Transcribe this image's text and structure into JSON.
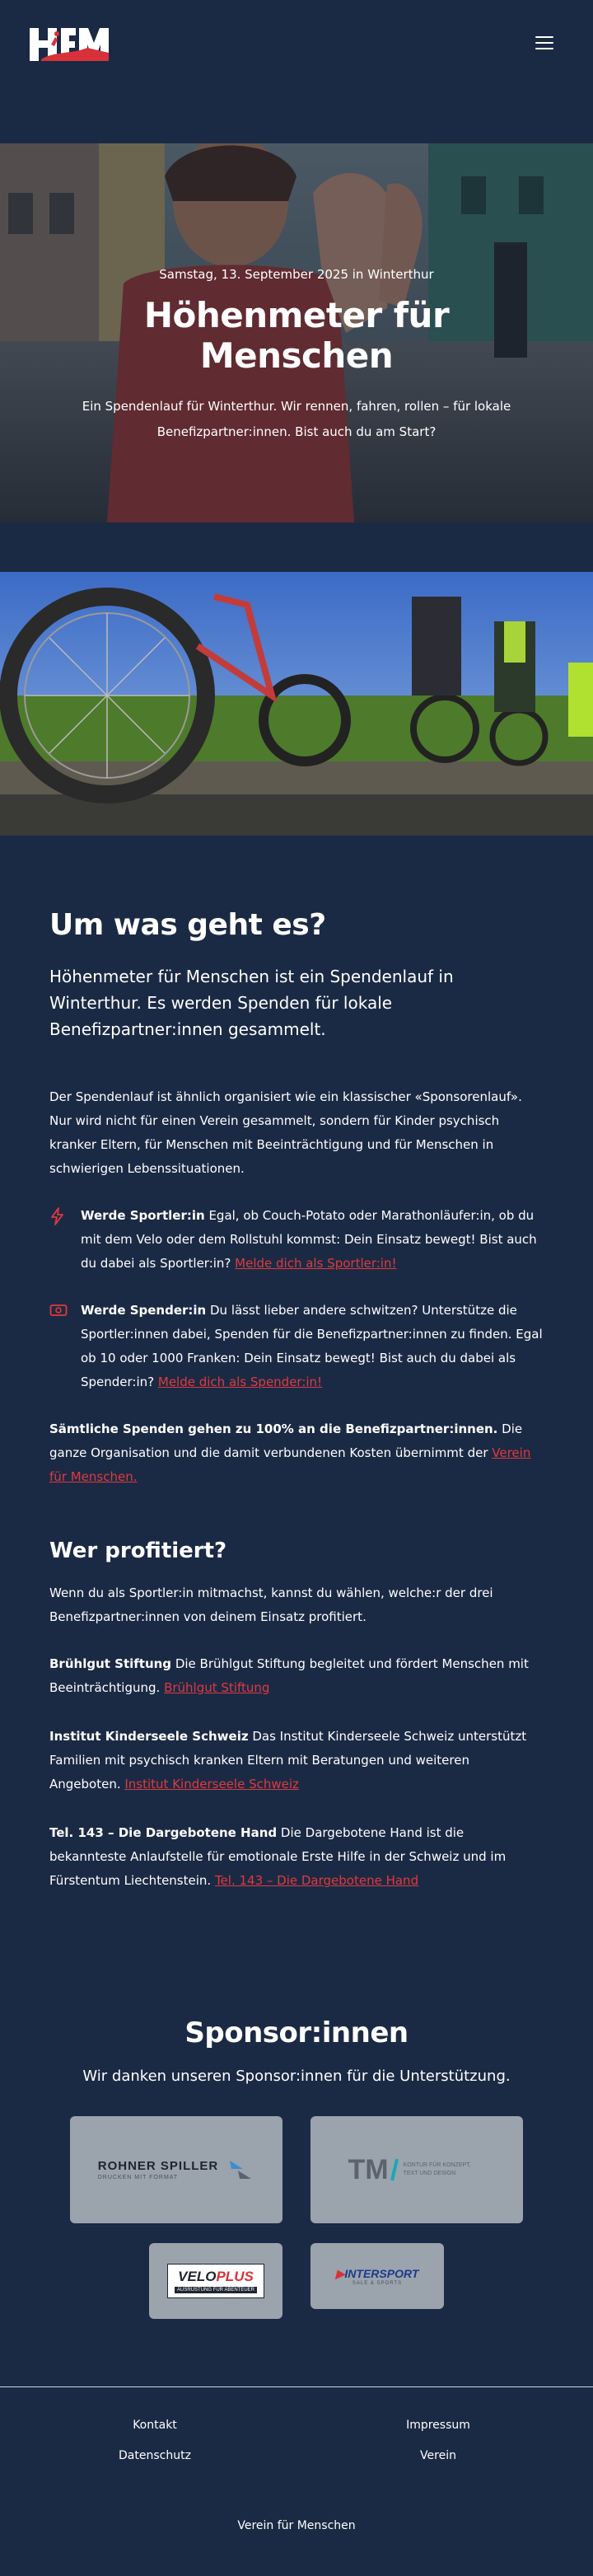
{
  "header": {
    "logo_text": "HfM",
    "menu_icon": "hamburger-icon"
  },
  "hero": {
    "date": "Samstag, 13. September 2025 in Winterthur",
    "title": "Höhenmeter für Menschen",
    "subtitle": "Ein Spendenlauf für Winterthur. Wir rennen, fahren, rollen – für lokale Benefizpartner:innen. Bist auch du am Start?"
  },
  "about": {
    "title": "Um was geht es?",
    "lead": "Höhenmeter für Menschen ist ein Spendenlauf in Winterthur. Es werden Spenden für lokale Benefizpartner:innen gesammelt.",
    "intro": "Der Spendenlauf ist ähnlich organisiert wie ein klassischer «Sponsorenlauf». Nur wird nicht für einen Verein gesammelt, sondern für Kinder psychisch kranker Eltern, für Menschen mit Beeinträchtigung und für Menschen in schwierigen Lebenssituationen.",
    "features": [
      {
        "icon": "lightning-icon",
        "title": "Werde Sportler:in",
        "text": " Egal, ob Couch-Potato oder Marathonläufer:in, ob du mit dem Velo oder dem Rollstuhl kommst: Dein Einsatz bewegt! Bist auch du dabei als Sportler:in? ",
        "link": "Melde dich als Sportler:in!"
      },
      {
        "icon": "money-icon",
        "title": "Werde Spender:in",
        "text": " Du lässt lieber andere schwitzen? Unterstütze die Sportler:innen dabei, Spenden für die Benefizpartner:innen zu finden. Egal ob 10 oder 1000 Franken: Dein Einsatz bewegt! Bist auch du dabei als Spender:in? ",
        "link": "Melde dich als Spender:in!"
      }
    ],
    "donation_bold": "Sämtliche Spenden gehen zu 100% an die Benefizpartner:innen.",
    "donation_text": " Die ganze Organisation und die damit verbundenen Kosten übernimmt der ",
    "donation_link": "Verein für Menschen."
  },
  "profit": {
    "title": "Wer profitiert?",
    "intro": "Wenn du als Sportler:in mitmachst, kannst du wählen, welche:r der drei Benefizpartner:innen von deinem Einsatz profitiert.",
    "partners": [
      {
        "name": "Brühlgut Stiftung",
        "text": " Die Brühlgut Stiftung begleitet und fördert Menschen mit Beeinträchtigung. ",
        "link": "Brühlgut Stiftung"
      },
      {
        "name": "Institut Kinderseele Schweiz",
        "text": " Das Institut Kinderseele Schweiz unterstützt Familien mit psychisch kranken Eltern mit Beratungen und weiteren Angeboten. ",
        "link": "Institut Kinderseele Schweiz"
      },
      {
        "name": "Tel. 143 – Die Dargebotene Hand",
        "text": " Die Dargebotene Hand ist die bekannteste Anlaufstelle für emotionale Erste Hilfe in der Schweiz und im Fürstentum Liechtenstein. ",
        "link": "Tel. 143 – Die Dargebotene Hand"
      }
    ]
  },
  "sponsors": {
    "title": "Sponsor:innen",
    "subtitle": "Wir danken unseren Sponsor:innen für die Unterstützung.",
    "rohner": {
      "name": "ROHNER SPILLER",
      "tagline": "DRUCKEN MIT FORMAT"
    },
    "tm": {
      "name": "TM",
      "tagline": "KONTUR FÜR KONZEPT, TEXT UND DESIGN"
    },
    "velo": {
      "name": "VELO",
      "accent": "PLUS",
      "tagline": "AUSRÜSTUNG FÜR ABENTEUER"
    },
    "intersport": {
      "name": "INTERSPORT",
      "tagline": "SALE & SPORTS"
    }
  },
  "footer": {
    "links_left": [
      "Kontakt",
      "Datenschutz"
    ],
    "links_right": [
      "Impressum",
      "Verein"
    ],
    "org": "Verein für Menschen"
  },
  "colors": {
    "background": "#1b2a44",
    "accent": "#e0393e",
    "logo_tile": "#9ba3ad"
  }
}
